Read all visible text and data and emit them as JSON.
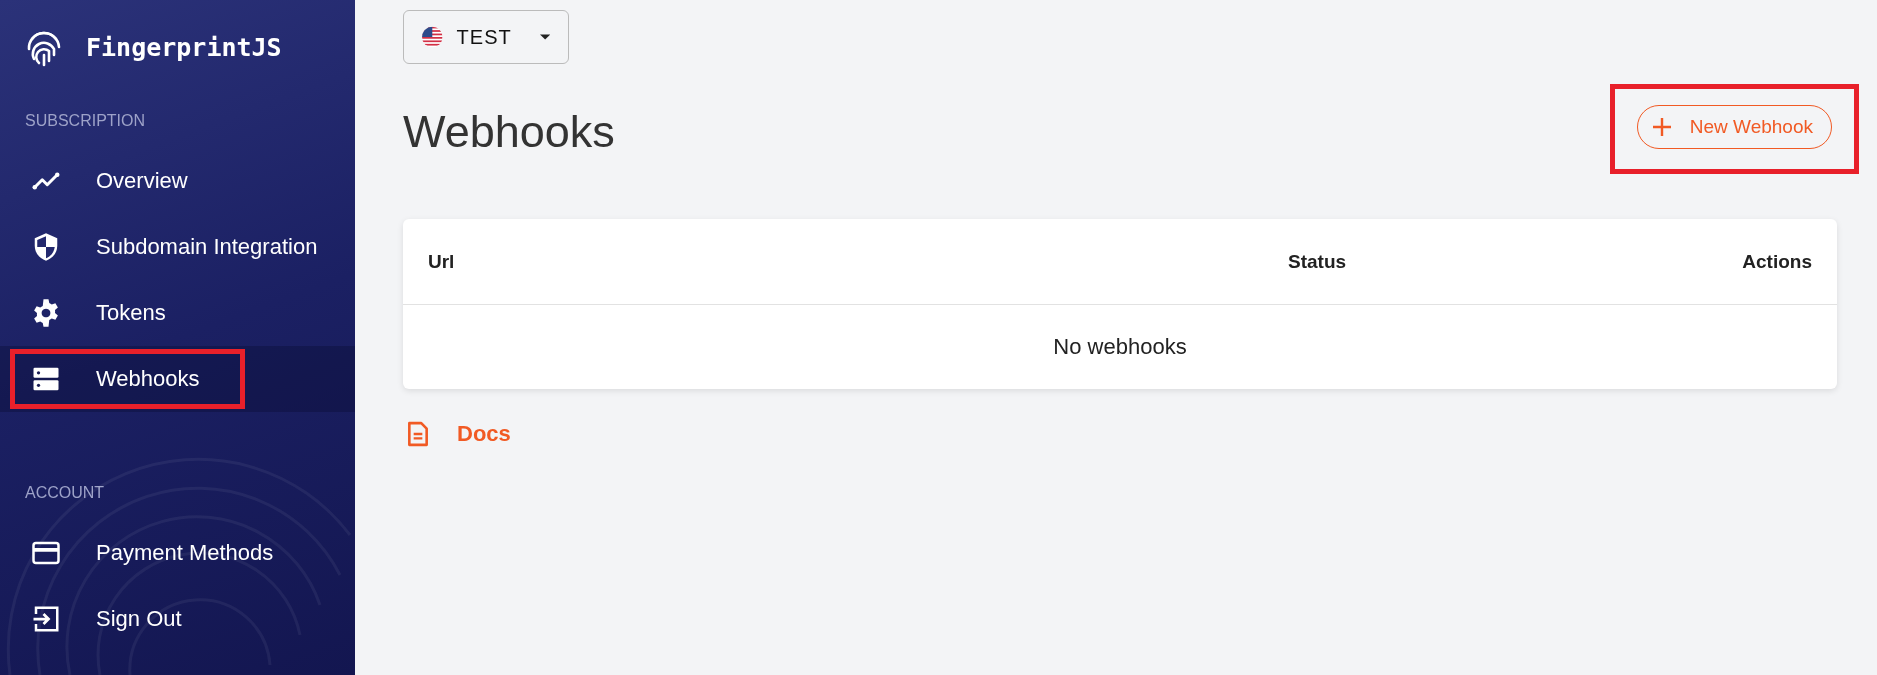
{
  "sidebar": {
    "brand": "FingerprintJS",
    "sections": [
      {
        "title": "SUBSCRIPTION",
        "items": [
          {
            "label": "Overview",
            "kind": "chart",
            "selected": false,
            "highlighted": false
          },
          {
            "label": "Subdomain Integration",
            "kind": "shield",
            "selected": false,
            "highlighted": false
          },
          {
            "label": "Tokens",
            "kind": "gear",
            "selected": false,
            "highlighted": false
          },
          {
            "label": "Webhooks",
            "kind": "server",
            "selected": true,
            "highlighted": true
          }
        ]
      },
      {
        "title": "ACCOUNT",
        "items": [
          {
            "label": "Payment Methods",
            "kind": "card",
            "selected": false,
            "highlighted": false
          },
          {
            "label": "Sign Out",
            "kind": "signout",
            "selected": false,
            "highlighted": false
          }
        ]
      }
    ]
  },
  "environment": {
    "label": "TEST"
  },
  "page": {
    "title": "Webhooks",
    "new_button": {
      "label": "New Webhook",
      "highlighted": true
    }
  },
  "table": {
    "columns": [
      "Url",
      "Status",
      "Actions"
    ],
    "empty_text": "No webhooks"
  },
  "docs_link": "Docs"
}
